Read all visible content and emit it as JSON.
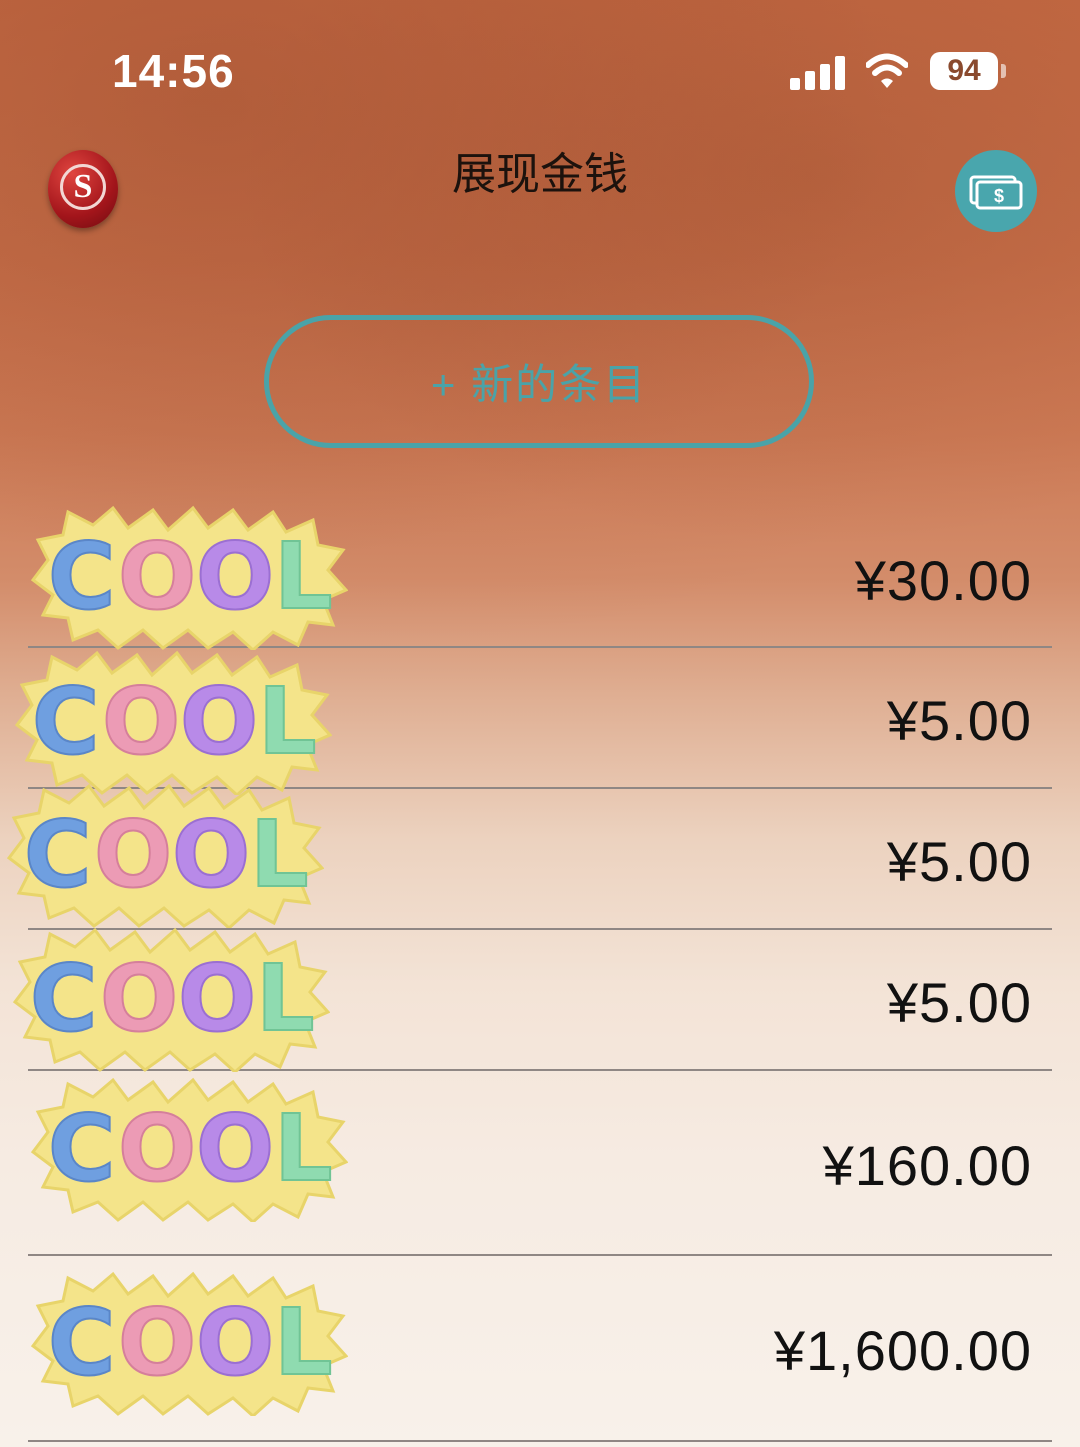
{
  "status_bar": {
    "time": "14:56",
    "battery": "94"
  },
  "header": {
    "title": "展现金钱",
    "logo_letter": "S"
  },
  "new_entry": {
    "label": "+ 新的条目"
  },
  "sticker_text": "COOL",
  "entries": [
    {
      "amount": "¥30.00"
    },
    {
      "amount": "¥5.00"
    },
    {
      "amount": "¥5.00"
    },
    {
      "amount": "¥5.00"
    },
    {
      "amount": "¥160.00"
    },
    {
      "amount": "¥1,600.00"
    }
  ],
  "colors": {
    "accent": "#4aa3a8",
    "text": "#111111"
  }
}
